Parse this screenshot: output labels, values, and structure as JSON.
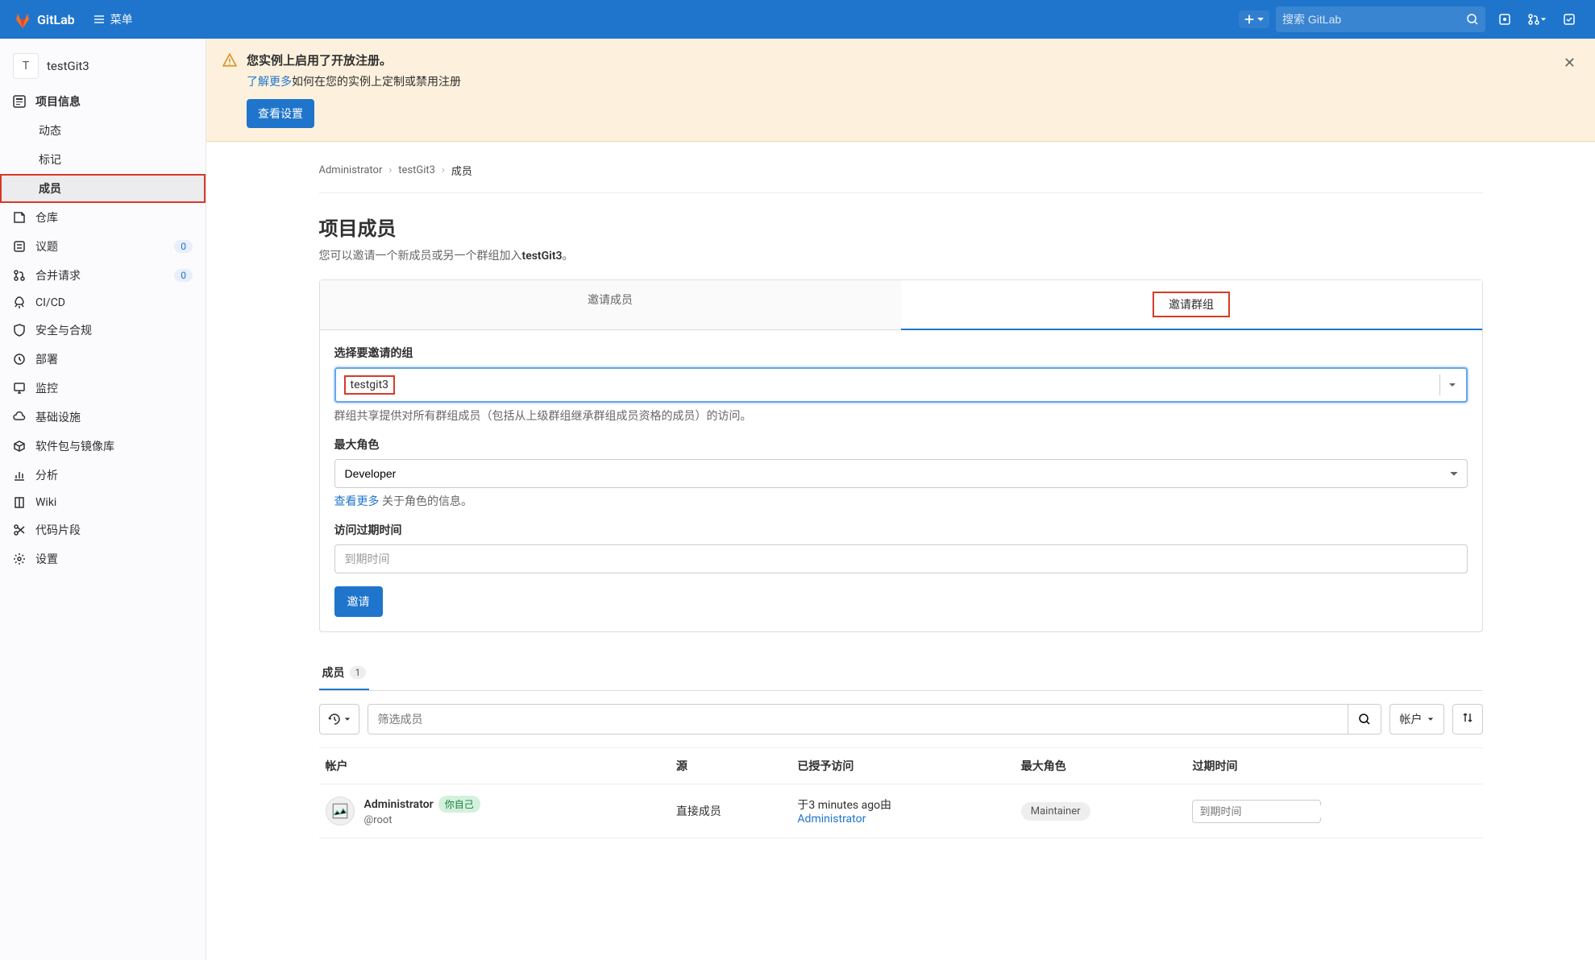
{
  "topbar": {
    "brand": "GitLab",
    "menu_label": "菜单",
    "search_placeholder": "搜索 GitLab"
  },
  "sidebar": {
    "project_initial": "T",
    "project_name": "testGit3",
    "items": [
      {
        "label": "项目信息",
        "icon": "info"
      },
      {
        "label": "动态",
        "sub": true
      },
      {
        "label": "标记",
        "sub": true
      },
      {
        "label": "成员",
        "sub": true,
        "active": true,
        "highlighted": true
      },
      {
        "label": "仓库",
        "icon": "repo"
      },
      {
        "label": "议题",
        "icon": "issues",
        "badge": "0"
      },
      {
        "label": "合并请求",
        "icon": "merge",
        "badge": "0"
      },
      {
        "label": "CI/CD",
        "icon": "rocket"
      },
      {
        "label": "安全与合规",
        "icon": "shield"
      },
      {
        "label": "部署",
        "icon": "deploy"
      },
      {
        "label": "监控",
        "icon": "monitor"
      },
      {
        "label": "基础设施",
        "icon": "cloud"
      },
      {
        "label": "软件包与镜像库",
        "icon": "package"
      },
      {
        "label": "分析",
        "icon": "chart"
      },
      {
        "label": "Wiki",
        "icon": "book"
      },
      {
        "label": "代码片段",
        "icon": "scissors"
      },
      {
        "label": "设置",
        "icon": "gear"
      }
    ]
  },
  "alert": {
    "title": "您实例上启用了开放注册。",
    "link_text": "了解更多",
    "text_rest": "如何在您的实例上定制或禁用注册",
    "button": "查看设置"
  },
  "breadcrumb": {
    "items": [
      "Administrator",
      "testGit3",
      "成员"
    ]
  },
  "page": {
    "title": "项目成员",
    "desc_prefix": "您可以邀请一个新成员或另一个群组加入",
    "desc_bold": "testGit3",
    "desc_suffix": "。"
  },
  "invite": {
    "tab_member": "邀请成员",
    "tab_group": "邀请群组",
    "group_label": "选择要邀请的组",
    "group_value": "testgit3",
    "group_help": "群组共享提供对所有群组成员（包括从上级群组继承群组成员资格的成员）的访问。",
    "role_label": "最大角色",
    "role_value": "Developer",
    "role_help_link": "查看更多",
    "role_help_rest": " 关于角色的信息。",
    "expiry_label": "访问过期时间",
    "expiry_placeholder": "到期时间",
    "submit": "邀请"
  },
  "members": {
    "tab_label": "成员",
    "count": "1",
    "filter_placeholder": "筛选成员",
    "sort_label": "帐户",
    "columns": {
      "account": "帐户",
      "source": "源",
      "granted": "已授予访问",
      "role": "最大角色",
      "expiry": "过期时间"
    },
    "rows": [
      {
        "name": "Administrator",
        "self_badge": "你自己",
        "handle": "@root",
        "source": "直接成员",
        "granted_prefix": "于3 minutes ago由",
        "granted_link": "Administrator",
        "role": "Maintainer",
        "expiry_placeholder": "到期时间"
      }
    ]
  }
}
